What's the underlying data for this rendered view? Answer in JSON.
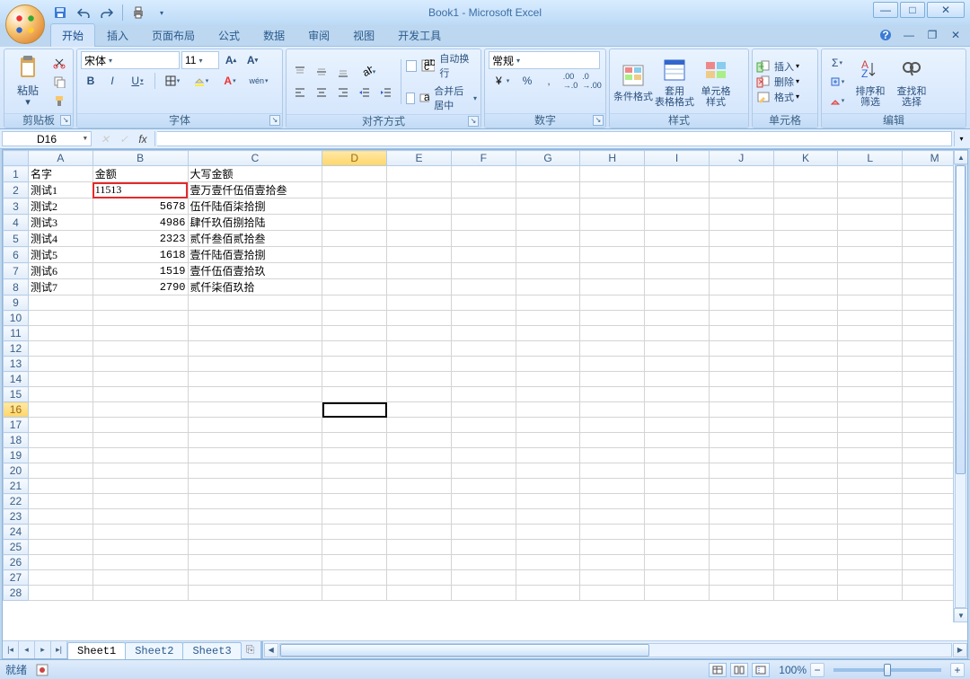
{
  "app_title": "Book1 - Microsoft Excel",
  "tabs": [
    "开始",
    "插入",
    "页面布局",
    "公式",
    "数据",
    "审阅",
    "视图",
    "开发工具"
  ],
  "active_tab": 0,
  "ribbon": {
    "clipboard": {
      "label": "剪贴板",
      "paste": "粘贴"
    },
    "font": {
      "label": "字体",
      "name": "宋体",
      "size": "11"
    },
    "alignment": {
      "label": "对齐方式",
      "wrap": "自动换行",
      "merge": "合并后居中"
    },
    "number": {
      "label": "数字",
      "format": "常规"
    },
    "styles": {
      "label": "样式",
      "cond": "条件格式",
      "table": "套用\n表格格式",
      "cell": "单元格\n样式"
    },
    "cells": {
      "label": "单元格",
      "insert": "插入",
      "delete": "删除",
      "format": "格式"
    },
    "editing": {
      "label": "编辑",
      "sort": "排序和\n筛选",
      "find": "查找和\n选择"
    }
  },
  "namebox": "D16",
  "formula": "",
  "columns": [
    "A",
    "B",
    "C",
    "D",
    "E",
    "F",
    "G",
    "H",
    "I",
    "J",
    "K",
    "L",
    "M"
  ],
  "col_widths": {
    "A": "col-A",
    "B": "col-B",
    "C": "col-C"
  },
  "data_rows": [
    {
      "A": "名字",
      "B": "金额",
      "C": "大写金额",
      "B_align": "txt"
    },
    {
      "A": "测试1",
      "B": "11513",
      "C": "壹万壹仟伍佰壹拾叁",
      "B_align": "txt",
      "highlight": true
    },
    {
      "A": "测试2",
      "B": "5678",
      "C": "伍仟陆佰柒拾捌",
      "B_align": "num"
    },
    {
      "A": "测试3",
      "B": "4986",
      "C": "肆仟玖佰捌拾陆",
      "B_align": "num"
    },
    {
      "A": "测试4",
      "B": "2323",
      "C": "贰仟叁佰贰拾叁",
      "B_align": "num"
    },
    {
      "A": "测试5",
      "B": "1618",
      "C": "壹仟陆佰壹拾捌",
      "B_align": "num"
    },
    {
      "A": "测试6",
      "B": "1519",
      "C": "壹仟伍佰壹拾玖",
      "B_align": "num"
    },
    {
      "A": "测试7",
      "B": "2790",
      "C": "贰仟柒佰玖拾",
      "B_align": "num"
    }
  ],
  "total_rows": 28,
  "selected": {
    "row": 16,
    "col": "D"
  },
  "sheets": [
    "Sheet1",
    "Sheet2",
    "Sheet3"
  ],
  "active_sheet": 0,
  "status": "就绪",
  "zoom": "100%"
}
